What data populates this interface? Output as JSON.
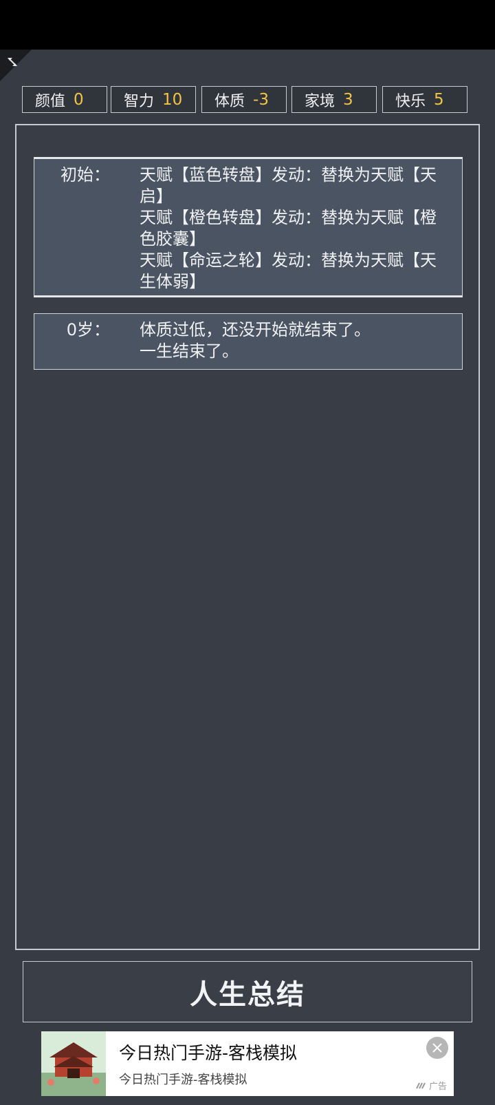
{
  "stats": [
    {
      "name": "颜值",
      "value": "0"
    },
    {
      "name": "智力",
      "value": "10"
    },
    {
      "name": "体质",
      "value": "-3"
    },
    {
      "name": "家境",
      "value": "3"
    },
    {
      "name": "快乐",
      "value": "5"
    }
  ],
  "log": [
    {
      "label": "初始：",
      "lines": [
        "天赋【蓝色转盘】发动：替换为天赋【天启】",
        "天赋【橙色转盘】发动：替换为天赋【橙色胶囊】",
        "天赋【命运之轮】发动：替换为天赋【天生体弱】"
      ]
    },
    {
      "label": "0岁：",
      "lines": [
        "体质过低，还没开始就结束了。",
        "一生结束了。"
      ]
    }
  ],
  "summary_button": "人生总结",
  "ad": {
    "title": "今日热门手游-客栈模拟",
    "subtitle": "今日热门手游-客栈模拟",
    "tag": "广告"
  },
  "colors": {
    "accent": "#f3c444",
    "background": "#373b43",
    "entry": "#4b5462"
  },
  "icons": {
    "corner": "expand-icon",
    "close": "close-icon"
  }
}
